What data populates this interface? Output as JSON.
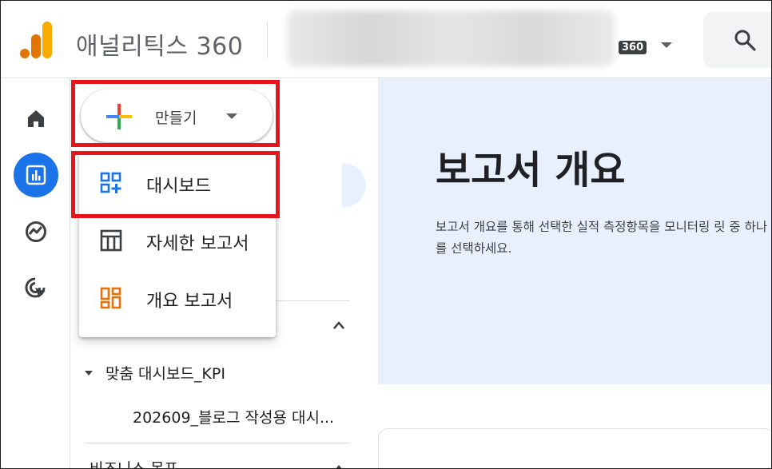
{
  "header": {
    "app_title": "애널리틱스 360",
    "account_badge": "360",
    "icons": {
      "logo": "analytics-logo-icon",
      "caret": "caret-down-icon",
      "search": "search-icon"
    }
  },
  "rail": {
    "items": [
      {
        "name": "home-icon",
        "active": false
      },
      {
        "name": "reports-icon",
        "active": true
      },
      {
        "name": "explore-icon",
        "active": false
      },
      {
        "name": "advertising-icon",
        "active": false
      }
    ]
  },
  "create_button": {
    "label": "만들기",
    "icon": "plus-icon",
    "caret": "caret-down-icon"
  },
  "create_menu": {
    "items": [
      {
        "label": "대시보드",
        "icon": "dashboard-add-icon",
        "icon_color": "#1a73e8"
      },
      {
        "label": "자세한 보고서",
        "icon": "table-icon",
        "icon_color": "#3c4043"
      },
      {
        "label": "개요 보고서",
        "icon": "overview-grid-icon",
        "icon_color": "#e8710a"
      }
    ]
  },
  "nav": {
    "folder_label": "맞춤 대시보드_KPI",
    "sub_item": "202609_블로그 작성용 대시...",
    "next_section": "비즈니스 목표"
  },
  "main": {
    "title": "보고서 개요",
    "description": "보고서 개요를 통해 선택한 실적 측정항목을 모니터링 릿 중 하나를 선택하세요."
  },
  "colors": {
    "accent": "#1a73e8",
    "hero_bg": "#e8f0fe",
    "annotation_red": "#e8141c",
    "orange": "#e8710a"
  }
}
